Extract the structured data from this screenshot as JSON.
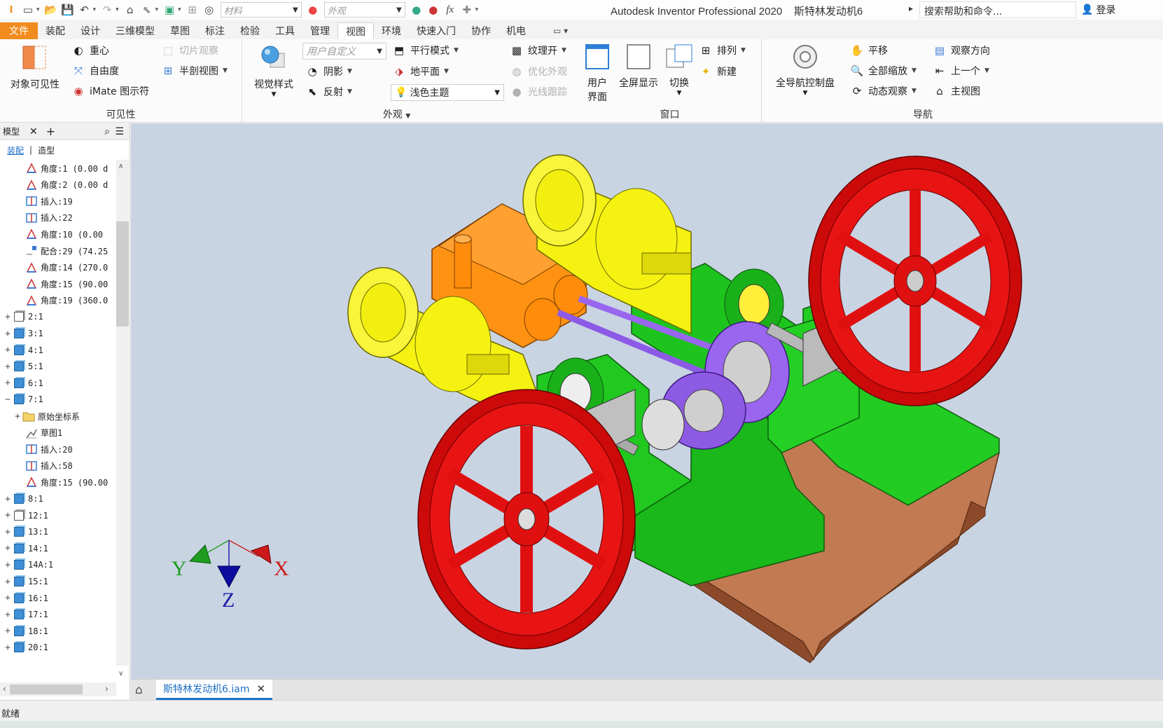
{
  "title_bar": {
    "app_title": "Autodesk Inventor Professional 2020",
    "doc_title": "斯特林发动机6",
    "material_placeholder": "材料",
    "appearance_placeholder": "外观",
    "search_placeholder": "搜索帮助和命令...",
    "login_label": "登录"
  },
  "tabs": [
    "文件",
    "装配",
    "设计",
    "三维模型",
    "草图",
    "标注",
    "检验",
    "工具",
    "管理",
    "视图",
    "环境",
    "快速入门",
    "协作",
    "机电"
  ],
  "active_tab": "视图",
  "ribbon": {
    "visibility": {
      "title": "可见性",
      "object_visibility": "对象可见性",
      "center_of_gravity": "重心",
      "dof": "自由度",
      "imate_glyphs": "iMate 图示符",
      "slice_graphics": "切片观察",
      "half_section": "半剖视图"
    },
    "appearance": {
      "title": "外观",
      "visual_style": "视觉样式",
      "user_defined": "用户自定义",
      "parallel_mode": "平行模式",
      "shadows": "阴影",
      "ground_plane": "地平面",
      "reflections": "反射",
      "light_theme": "浅色主题",
      "texture_on": "纹理开",
      "optimize_appearance": "优化外观",
      "ray_tracing": "光线跟踪"
    },
    "window": {
      "title": "窗口",
      "user_interface_1": "用户",
      "user_interface_2": "界面",
      "full_screen": "全屏显示",
      "switch": "切换",
      "arrange": "排列",
      "new": "新建"
    },
    "navigate": {
      "title": "导航",
      "full_nav_wheel": "全导航控制盘",
      "pan": "平移",
      "zoom_all": "全部缩放",
      "orbit": "动态观察",
      "look_at": "观察方向",
      "previous": "上一个",
      "home_view": "主视图"
    }
  },
  "browser": {
    "title": "模型",
    "sub_tabs": [
      "装配",
      "造型"
    ],
    "rows": [
      {
        "label": "角度:1 (0.00 d",
        "type": "angle",
        "indent": 2
      },
      {
        "label": "角度:2 (0.00 d",
        "type": "angle",
        "indent": 2
      },
      {
        "label": "插入:19",
        "type": "insert",
        "indent": 2
      },
      {
        "label": "插入:22",
        "type": "insert",
        "indent": 2
      },
      {
        "label": "角度:10 (0.00",
        "type": "angle",
        "indent": 2
      },
      {
        "label": "配合:29 (74.25",
        "type": "mate",
        "indent": 2
      },
      {
        "label": "角度:14 (270.0",
        "type": "angle",
        "indent": 2
      },
      {
        "label": "角度:15 (90.00",
        "type": "angle",
        "indent": 2
      },
      {
        "label": "角度:19 (360.0",
        "type": "angle",
        "indent": 2
      },
      {
        "label": "2:1",
        "type": "part-multi",
        "indent": 0,
        "exp": "+"
      },
      {
        "label": "3:1",
        "type": "part",
        "indent": 0,
        "exp": "+"
      },
      {
        "label": "4:1",
        "type": "part",
        "indent": 0,
        "exp": "+"
      },
      {
        "label": "5:1",
        "type": "part",
        "indent": 0,
        "exp": "+"
      },
      {
        "label": "6:1",
        "type": "part",
        "indent": 0,
        "exp": "+"
      },
      {
        "label": "7:1",
        "type": "part",
        "indent": 0,
        "exp": "−"
      },
      {
        "label": "原始坐标系",
        "type": "folder",
        "indent": 1,
        "exp": "+"
      },
      {
        "label": "草图1",
        "type": "sketch",
        "indent": 2
      },
      {
        "label": "插入:20",
        "type": "insert",
        "indent": 2
      },
      {
        "label": "插入:58",
        "type": "insert",
        "indent": 2
      },
      {
        "label": "角度:15 (90.00",
        "type": "angle",
        "indent": 2
      },
      {
        "label": "8:1",
        "type": "part",
        "indent": 0,
        "exp": "+"
      },
      {
        "label": "12:1",
        "type": "part-multi",
        "indent": 0,
        "exp": "+"
      },
      {
        "label": "13:1",
        "type": "part",
        "indent": 0,
        "exp": "+"
      },
      {
        "label": "14:1",
        "type": "part",
        "indent": 0,
        "exp": "+"
      },
      {
        "label": "14A:1",
        "type": "part",
        "indent": 0,
        "exp": "+"
      },
      {
        "label": "15:1",
        "type": "part",
        "indent": 0,
        "exp": "+"
      },
      {
        "label": "16:1",
        "type": "part",
        "indent": 0,
        "exp": "+"
      },
      {
        "label": "17:1",
        "type": "part",
        "indent": 0,
        "exp": "+"
      },
      {
        "label": "18:1",
        "type": "part",
        "indent": 0,
        "exp": "+"
      },
      {
        "label": "20:1",
        "type": "part",
        "indent": 0,
        "exp": "+"
      }
    ]
  },
  "viewport": {
    "axis_x": "X",
    "axis_y": "Y",
    "axis_z": "Z",
    "colors": {
      "base": "#b9704a",
      "frame": "#19c219",
      "flywheel": "#e01010",
      "cylinder": "#f2ef10",
      "block": "#ff8c0a",
      "rod": "#9966ee",
      "metal": "#b8b8b8",
      "background": "#c9d4e3"
    }
  },
  "document_tab": "斯特林发动机6.iam",
  "status": "就绪"
}
